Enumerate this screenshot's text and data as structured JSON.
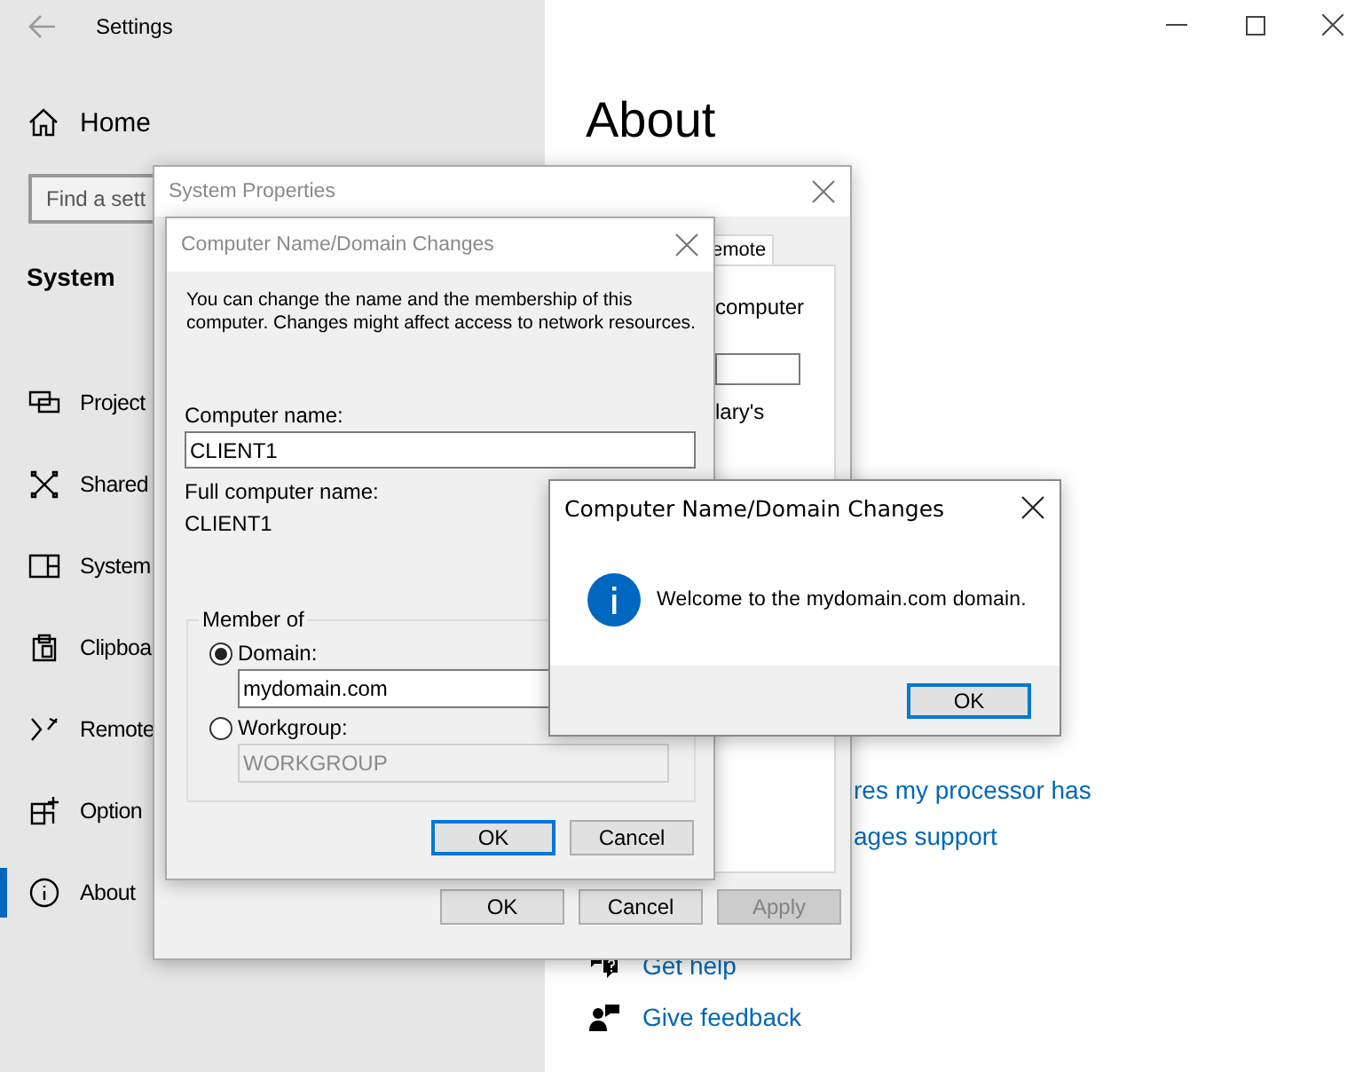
{
  "settings": {
    "title": "Settings",
    "home": "Home",
    "search": {
      "placeholder": "Find a sett"
    },
    "section": "System",
    "items": [
      {
        "label": "Project",
        "selected": false
      },
      {
        "label": "Shared",
        "selected": false
      },
      {
        "label": "System",
        "selected": false
      },
      {
        "label": "Clipboa",
        "selected": false
      },
      {
        "label": "Remote",
        "selected": false
      },
      {
        "label": "Option",
        "selected": false
      },
      {
        "label": "About",
        "selected": true
      }
    ],
    "heading": "About",
    "links": [
      "res my processor has",
      "ages support"
    ],
    "help": [
      "Get help",
      "Give feedback"
    ]
  },
  "system_properties": {
    "title": "System Properties",
    "active": false,
    "tab": "emote",
    "panel_texts": [
      "computer",
      "lary's"
    ],
    "buttons": [
      {
        "label": "OK",
        "disabled": false
      },
      {
        "label": "Cancel",
        "disabled": false
      },
      {
        "label": "Apply",
        "disabled": true
      }
    ]
  },
  "name_dialog": {
    "title": "Computer Name/Domain Changes",
    "active": false,
    "description": "You can change the name and the membership of this computer. Changes might affect access to network resources.",
    "computer_name_label": "Computer name:",
    "computer_name": "CLIENT1",
    "full_name_label": "Full computer name:",
    "full_name": "CLIENT1",
    "member_of": {
      "legend": "Member of",
      "options": [
        {
          "label": "Domain:",
          "selected": true,
          "value": "mydomain.com"
        },
        {
          "label": "Workgroup:",
          "selected": false,
          "value": "WORKGROUP"
        }
      ]
    },
    "buttons": [
      {
        "label": "OK",
        "focused": true
      },
      {
        "label": "Cancel",
        "focused": false
      }
    ]
  },
  "message": {
    "title": "Computer Name/Domain Changes",
    "active": true,
    "text": "Welcome to the mydomain.com domain.",
    "button": {
      "label": "OK",
      "focused": true
    }
  }
}
